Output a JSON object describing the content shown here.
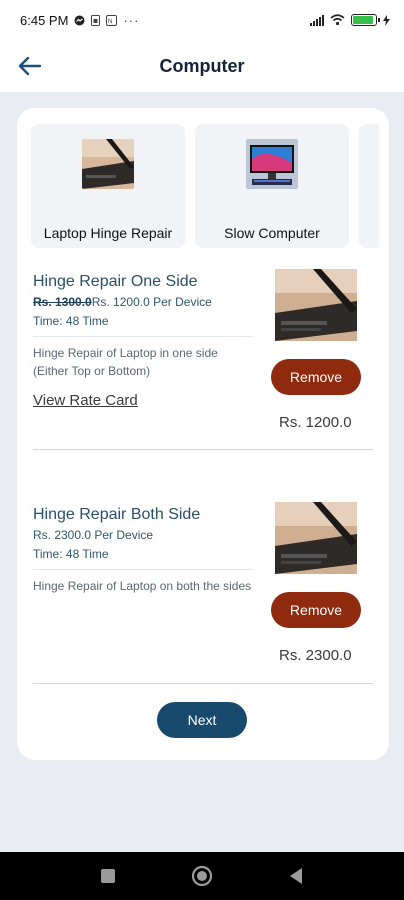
{
  "status_bar": {
    "time": "6:45 PM",
    "icons": [
      "messenger-icon",
      "sim-icon",
      "nfc-icon",
      "more-dots-icon",
      "signal-icon",
      "wifi-icon",
      "battery-icon",
      "charging-icon"
    ],
    "more": "···",
    "battery_level": 0.9
  },
  "header": {
    "title": "Computer",
    "back_icon": "arrow-left-icon"
  },
  "categories": [
    {
      "label": "Laptop Hinge Repair",
      "icon": "laptop-thumbnail"
    },
    {
      "label": "Slow Computer",
      "icon": "desktop-thumbnail"
    },
    {
      "label": "",
      "icon": ""
    }
  ],
  "services": [
    {
      "title": "Hinge Repair One Side",
      "old_price": "Rs. 1300.0",
      "price": "Rs. 1200.0 Per Device",
      "time": "Time: 48 Time",
      "description": "Hinge Repair of Laptop in one side (Either Top or Bottom)",
      "rate_card": "View Rate Card",
      "button": "Remove",
      "total": "Rs. 1200.0"
    },
    {
      "title": "Hinge Repair Both Side",
      "price": "Rs. 2300.0 Per Device",
      "time": "Time: 48 Time",
      "description": "Hinge Repair of Laptop on both the sides",
      "button": "Remove",
      "total": "Rs. 2300.0"
    }
  ],
  "next_button": "Next",
  "nav_bar": {
    "icons": [
      "recents-square-icon",
      "home-circle-icon",
      "back-triangle-icon"
    ]
  },
  "colors": {
    "remove": "#8f2a0f",
    "next": "#174a6d",
    "title_blue": "#2a4f6d",
    "background": "#e9edf3"
  }
}
